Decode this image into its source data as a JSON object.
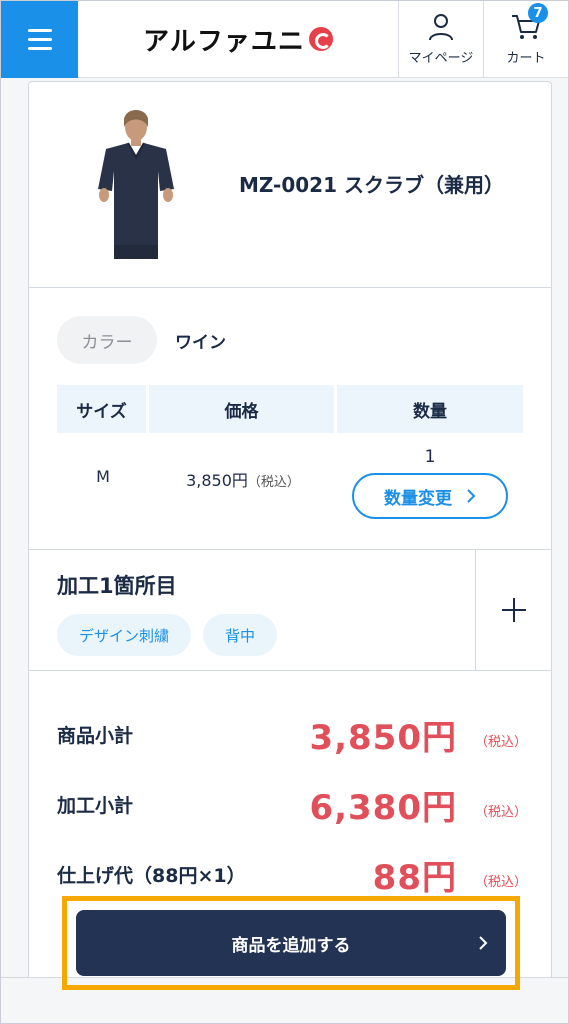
{
  "header": {
    "logo_text": "アルファユニ",
    "mypage_label": "マイページ",
    "cart_label": "カート",
    "cart_count": "7"
  },
  "product": {
    "name": "MZ-0021 スクラブ（兼用）"
  },
  "detail": {
    "color_label": "カラー",
    "color_value": "ワイン",
    "table": {
      "headers": [
        "サイズ",
        "価格",
        "数量"
      ],
      "size": "M",
      "price": "3,850円",
      "price_tax": "（税込）",
      "qty": "1",
      "qty_button": "数量変更"
    }
  },
  "process": {
    "title": "加工1箇所目",
    "tags": [
      "デザイン刺繍",
      "背中"
    ]
  },
  "totals": [
    {
      "label": "商品小計",
      "value": "3,850円",
      "tax": "（税込）"
    },
    {
      "label": "加工小計",
      "value": "6,380円",
      "tax": "（税込）"
    },
    {
      "label": "仕上げ代（88円×1）",
      "value": "88円",
      "tax": "（税込）"
    }
  ],
  "add_button": "商品を追加する",
  "colors": {
    "accent": "#1a90e8",
    "price": "#e04f5a",
    "primary_button": "#223354",
    "highlight": "#f5a800"
  }
}
